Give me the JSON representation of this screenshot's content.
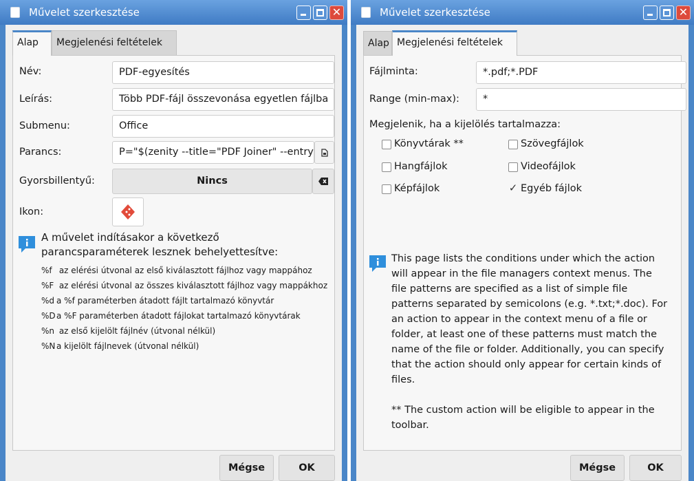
{
  "left_window": {
    "title": "Művelet szerkesztése",
    "tabs": [
      "Alap",
      "Megjelenési feltételek"
    ],
    "fields": {
      "name_label": "Név:",
      "name_value": "PDF-egyesítés",
      "desc_label": "Leírás:",
      "desc_value": "Több PDF-fájl összevonása egyetlen fájlba",
      "submenu_label": "Submenu:",
      "submenu_value": "Office",
      "command_label": "Parancs:",
      "command_value": "P=\"$(zenity --title=\"PDF Joiner\" --entry --text",
      "shortcut_label": "Gyorsbillentyű:",
      "shortcut_value": "Nincs",
      "icon_label": "Ikon:"
    },
    "info_heading_line1": "A művelet indításakor a következő",
    "info_heading_line2": "parancsparaméterek lesznek behelyettesítve:",
    "params": [
      {
        "code": "%f",
        "text": " az elérési útvonal az első kiválasztott fájlhoz vagy mappához"
      },
      {
        "code": "%F",
        "text": " az elérési útvonal az összes kiválasztott fájlhoz vagy mappákhoz"
      },
      {
        "code": "%d",
        "text": "a %f paraméterben átadott fájlt tartalmazó könyvtár"
      },
      {
        "code": "%D",
        "text": "a %F paraméterben átadott fájlokat tartalmazó könyvtárak"
      },
      {
        "code": "%n",
        "text": " az első kijelölt fájlnév (útvonal nélkül)"
      },
      {
        "code": "%N",
        "text": "a kijelölt fájlnevek (útvonal nélkül)"
      }
    ],
    "cancel_label": "Mégse",
    "ok_label": "OK"
  },
  "right_window": {
    "title": "Művelet szerkesztése",
    "tabs": [
      "Alap",
      "Megjelenési feltételek"
    ],
    "pattern_label": "Fájlminta:",
    "pattern_value": "*.pdf;*.PDF",
    "range_label": "Range (min-max):",
    "range_value": "*",
    "appears_label": "Megjelenik, ha a kijelölés tartalmazza:",
    "checkboxes": [
      {
        "label": "Könyvtárak **",
        "checked": false
      },
      {
        "label": "Szövegfájlok",
        "checked": false
      },
      {
        "label": "Hangfájlok",
        "checked": false
      },
      {
        "label": "Videofájlok",
        "checked": false
      },
      {
        "label": "Képfájlok",
        "checked": false
      },
      {
        "label": "Egyéb fájlok",
        "checked": true
      }
    ],
    "help_lines": [
      "This page lists the conditions under which the action",
      "will appear in the file managers context menus. The",
      "file patterns are specified as a list of simple file",
      "patterns separated by semicolons (e.g. *.txt;*.doc). For",
      "an action to appear in the context menu of a file or",
      "folder, at least one of these patterns must match the",
      "name of the file or folder. Additionally, you can specify",
      "that the action should only appear for certain kinds of",
      "files.",
      "",
      "** The custom action will be eligible to appear in the",
      "toolbar."
    ],
    "cancel_label": "Mégse",
    "ok_label": "OK"
  },
  "icons": {
    "app": "window-app-icon",
    "minimize": "minimize-icon",
    "maximize": "maximize-icon",
    "close": "close-icon",
    "file_chooser": "document-open-icon",
    "clear": "backspace-clear-icon",
    "action_icon": "ruby-gem-icon",
    "info": "info-icon"
  },
  "colors": {
    "titlebar": "#4a86c8",
    "close": "#dd4a3c",
    "tab_accent": "#4a86c8",
    "info_blue": "#2f8fdc",
    "gem_red": "#e24b3a"
  }
}
